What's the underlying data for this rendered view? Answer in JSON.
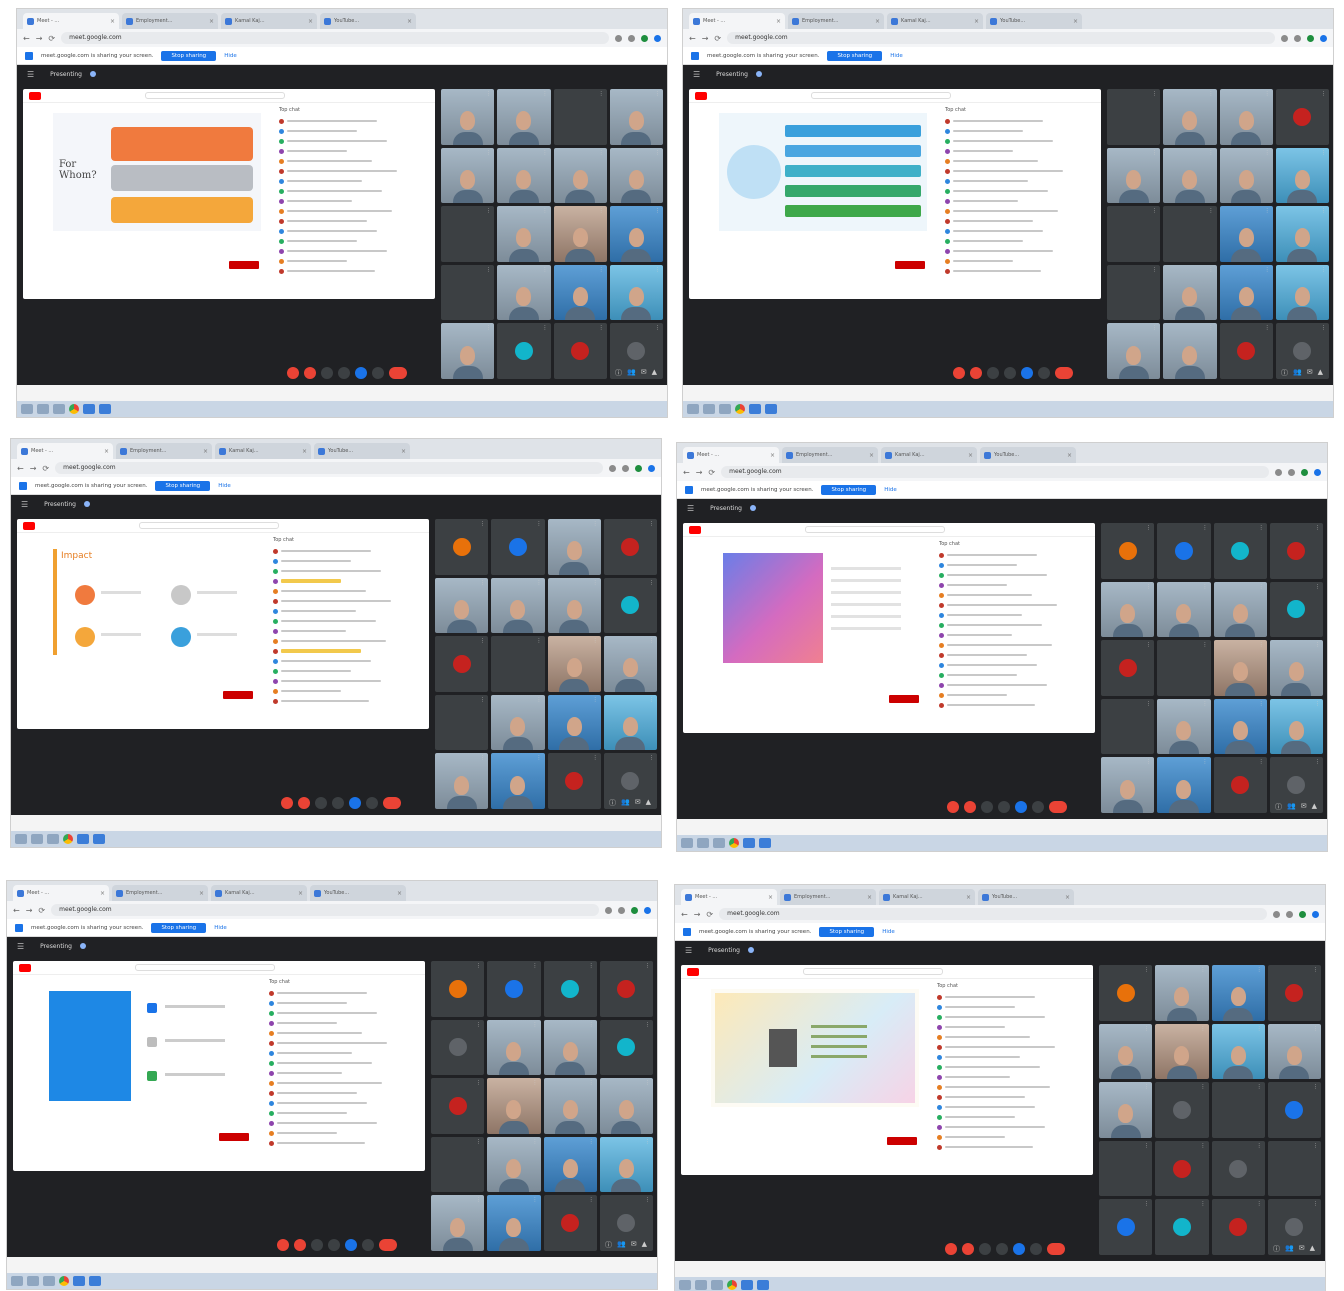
{
  "panels": [
    {
      "tabs": [
        "Meet - ...",
        "Employment...",
        "Kamal Kaj...",
        "YouTube..."
      ],
      "url": "meet.google.com",
      "infobar_msg": "meet.google.com is sharing your screen.",
      "stop_label": "Stop sharing",
      "hide_label": "Hide",
      "meet_title": "",
      "presenting": "Presenting",
      "clock": "",
      "slide": "orange",
      "slide_text": "For Whom?",
      "video_title": "",
      "video_stats": "",
      "channel": "",
      "chat_header": "Top chat",
      "tiles": [
        "person",
        "person",
        "dark",
        "person",
        "person",
        "person",
        "person",
        "person",
        "dark",
        "person",
        "person warm",
        "person blue",
        "dark",
        "person",
        "person blue",
        "person cyan",
        "person",
        "avatar",
        "avatar",
        "avatar"
      ]
    },
    {
      "tabs": [
        "Meet - ...",
        "Employment...",
        "Kamal Kaj...",
        "YouTube..."
      ],
      "url": "meet.google.com",
      "infobar_msg": "meet.google.com is sharing your screen.",
      "stop_label": "Stop sharing",
      "hide_label": "Hide",
      "meet_title": "",
      "presenting": "Presenting",
      "clock": "",
      "slide": "blue",
      "slide_text": "",
      "video_title": "",
      "video_stats": "",
      "channel": "",
      "chat_header": "Top chat",
      "tiles": [
        "dark",
        "person",
        "person",
        "avatar",
        "person",
        "person",
        "person",
        "person cyan",
        "dark",
        "dark",
        "person blue",
        "person cyan",
        "dark",
        "person",
        "person blue",
        "person cyan",
        "person",
        "person",
        "avatar",
        "avatar"
      ]
    },
    {
      "tabs": [
        "Meet - ...",
        "Employment...",
        "Kamal Kaj...",
        "YouTube..."
      ],
      "url": "meet.google.com",
      "infobar_msg": "meet.google.com is sharing your screen.",
      "stop_label": "Stop sharing",
      "hide_label": "Hide",
      "meet_title": "",
      "presenting": "Presenting",
      "clock": "",
      "slide": "impact",
      "slide_text": "Impact",
      "video_title": "",
      "video_stats": "",
      "channel": "",
      "chat_header": "Top chat",
      "tiles": [
        "avatar",
        "avatar",
        "person",
        "avatar",
        "person",
        "person",
        "person",
        "avatar",
        "avatar",
        "dark",
        "person warm",
        "person",
        "dark",
        "person",
        "person blue",
        "person cyan",
        "person",
        "person blue",
        "avatar",
        "avatar"
      ]
    },
    {
      "tabs": [
        "Meet - ...",
        "Employment...",
        "Kamal Kaj...",
        "YouTube..."
      ],
      "url": "meet.google.com",
      "infobar_msg": "meet.google.com is sharing your screen.",
      "stop_label": "Stop sharing",
      "hide_label": "Hide",
      "meet_title": "",
      "presenting": "Presenting",
      "clock": "",
      "slide": "pink",
      "slide_text": "",
      "video_title": "",
      "video_stats": "",
      "channel": "",
      "chat_header": "Top chat",
      "tiles": [
        "avatar",
        "avatar",
        "avatar",
        "avatar",
        "person",
        "person",
        "person",
        "avatar",
        "avatar",
        "dark",
        "person warm",
        "person",
        "dark",
        "person",
        "person blue",
        "person cyan",
        "person",
        "person blue",
        "avatar",
        "avatar"
      ]
    },
    {
      "tabs": [
        "Meet - ...",
        "Employment...",
        "Kamal Kaj...",
        "YouTube..."
      ],
      "url": "meet.google.com",
      "infobar_msg": "meet.google.com is sharing your screen.",
      "stop_label": "Stop sharing",
      "hide_label": "Hide",
      "meet_title": "",
      "presenting": "Presenting",
      "clock": "",
      "slide": "bluebox",
      "slide_text": "",
      "video_title": "",
      "video_stats": "",
      "channel": "",
      "chat_header": "Top chat",
      "tiles": [
        "avatar",
        "avatar",
        "avatar",
        "avatar",
        "avatar",
        "person",
        "person",
        "avatar",
        "avatar",
        "person warm",
        "person",
        "person",
        "dark",
        "person",
        "person blue",
        "person cyan",
        "person",
        "person blue",
        "avatar",
        "avatar"
      ]
    },
    {
      "tabs": [
        "Meet - ...",
        "Employment...",
        "Kamal Kaj...",
        "YouTube..."
      ],
      "url": "meet.google.com",
      "infobar_msg": "meet.google.com is sharing your screen.",
      "stop_label": "Stop sharing",
      "hide_label": "Hide",
      "meet_title": "",
      "presenting": "Presenting",
      "clock": "",
      "slide": "note",
      "slide_text": "",
      "video_title": "",
      "video_stats": "",
      "channel": "",
      "chat_header": "Top chat",
      "tiles": [
        "avatar",
        "person",
        "person blue",
        "avatar",
        "person",
        "person warm",
        "person cyan",
        "person",
        "person",
        "avatar",
        "dark",
        "avatar",
        "dark",
        "avatar",
        "avatar",
        "dark",
        "avatar",
        "avatar",
        "avatar",
        "avatar"
      ]
    }
  ],
  "colors": {
    "meet_bg": "#202124",
    "accent": "#1a73e8",
    "end_call": "#ea4335"
  }
}
